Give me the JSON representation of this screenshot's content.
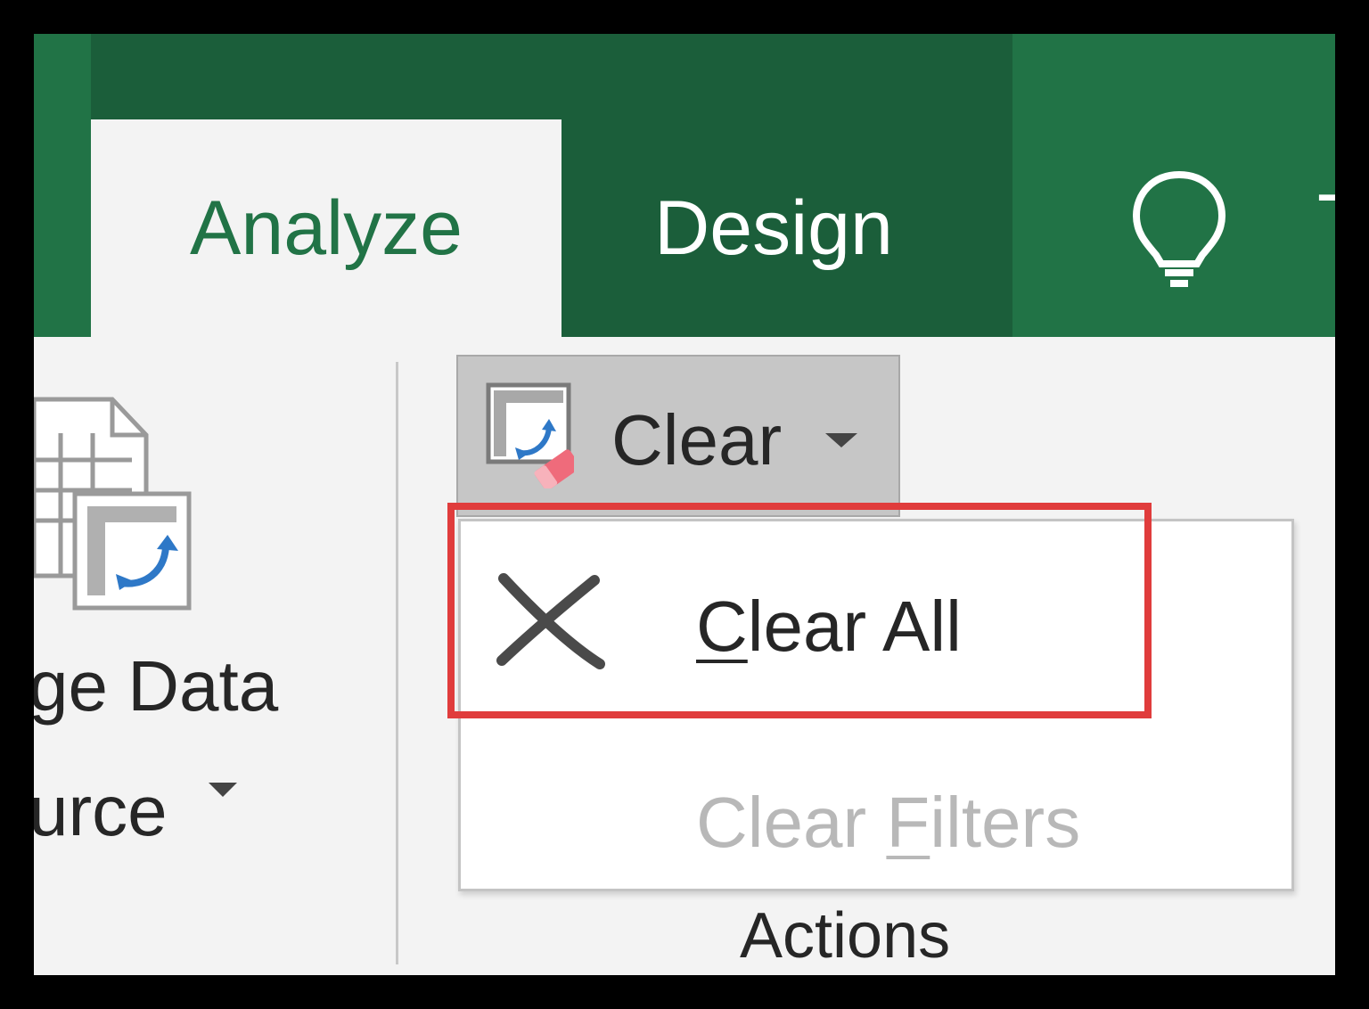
{
  "ribbon": {
    "tabs": [
      {
        "label": "Analyze",
        "active": true
      },
      {
        "label": "Design",
        "active": false
      }
    ],
    "tell_me_partial": "T",
    "colors": {
      "brand_green": "#217346",
      "tab_dark": "#1b5e3a",
      "highlight": "#e03c3c"
    }
  },
  "change_source": {
    "label_line1": "ge Data",
    "label_line2": "urce",
    "icon": "change-data-source-icon"
  },
  "actions_group": {
    "clear_button": {
      "label": "Clear",
      "icon": "clear-eraser-icon"
    },
    "menu": [
      {
        "pre": "",
        "underlined": "C",
        "post": "lear All",
        "enabled": true,
        "icon": "close-x-icon"
      },
      {
        "pre": "Clear ",
        "underlined": "F",
        "post": "ilters",
        "enabled": false
      }
    ],
    "group_label": "Actions"
  }
}
